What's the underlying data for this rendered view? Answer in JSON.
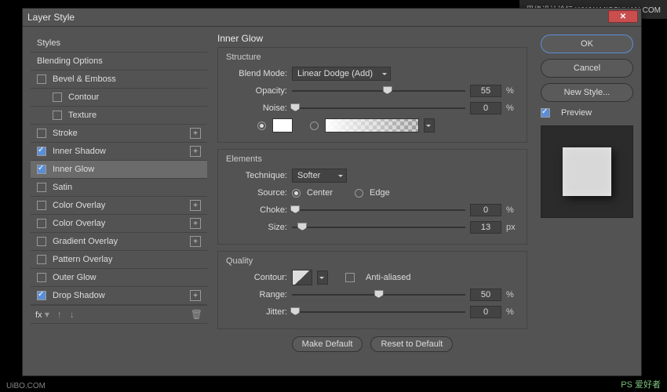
{
  "window": {
    "title": "Layer Style"
  },
  "watermark_top": "思缘设计论坛 WWW.MISSYUAN.COM",
  "watermark_br": "PS 爱好者",
  "watermark_bl": "UiBO.COM",
  "sidebar": {
    "styles": "Styles",
    "blending": "Blending Options",
    "items": [
      {
        "label": "Bevel & Emboss",
        "checked": false,
        "plus": false,
        "indent": false,
        "selected": false
      },
      {
        "label": "Contour",
        "checked": false,
        "plus": false,
        "indent": true,
        "selected": false
      },
      {
        "label": "Texture",
        "checked": false,
        "plus": false,
        "indent": true,
        "selected": false
      },
      {
        "label": "Stroke",
        "checked": false,
        "plus": true,
        "indent": false,
        "selected": false
      },
      {
        "label": "Inner Shadow",
        "checked": true,
        "plus": true,
        "indent": false,
        "selected": false
      },
      {
        "label": "Inner Glow",
        "checked": true,
        "plus": false,
        "indent": false,
        "selected": true
      },
      {
        "label": "Satin",
        "checked": false,
        "plus": false,
        "indent": false,
        "selected": false
      },
      {
        "label": "Color Overlay",
        "checked": false,
        "plus": true,
        "indent": false,
        "selected": false
      },
      {
        "label": "Color Overlay",
        "checked": false,
        "plus": true,
        "indent": false,
        "selected": false
      },
      {
        "label": "Gradient Overlay",
        "checked": false,
        "plus": true,
        "indent": false,
        "selected": false
      },
      {
        "label": "Pattern Overlay",
        "checked": false,
        "plus": false,
        "indent": false,
        "selected": false
      },
      {
        "label": "Outer Glow",
        "checked": false,
        "plus": false,
        "indent": false,
        "selected": false
      },
      {
        "label": "Drop Shadow",
        "checked": true,
        "plus": true,
        "indent": false,
        "selected": false
      }
    ],
    "fx": "fx"
  },
  "panel": {
    "title": "Inner Glow",
    "structure": {
      "heading": "Structure",
      "blend_mode_label": "Blend Mode:",
      "blend_mode_value": "Linear Dodge (Add)",
      "opacity_label": "Opacity:",
      "opacity_value": "55",
      "noise_label": "Noise:",
      "noise_value": "0",
      "pct": "%"
    },
    "elements": {
      "heading": "Elements",
      "technique_label": "Technique:",
      "technique_value": "Softer",
      "source_label": "Source:",
      "center": "Center",
      "edge": "Edge",
      "choke_label": "Choke:",
      "choke_value": "0",
      "size_label": "Size:",
      "size_value": "13",
      "px": "px",
      "pct": "%"
    },
    "quality": {
      "heading": "Quality",
      "contour_label": "Contour:",
      "aa": "Anti-aliased",
      "range_label": "Range:",
      "range_value": "50",
      "jitter_label": "Jitter:",
      "jitter_value": "0",
      "pct": "%"
    },
    "make_default": "Make Default",
    "reset_default": "Reset to Default"
  },
  "right": {
    "ok": "OK",
    "cancel": "Cancel",
    "new_style": "New Style...",
    "preview": "Preview"
  }
}
